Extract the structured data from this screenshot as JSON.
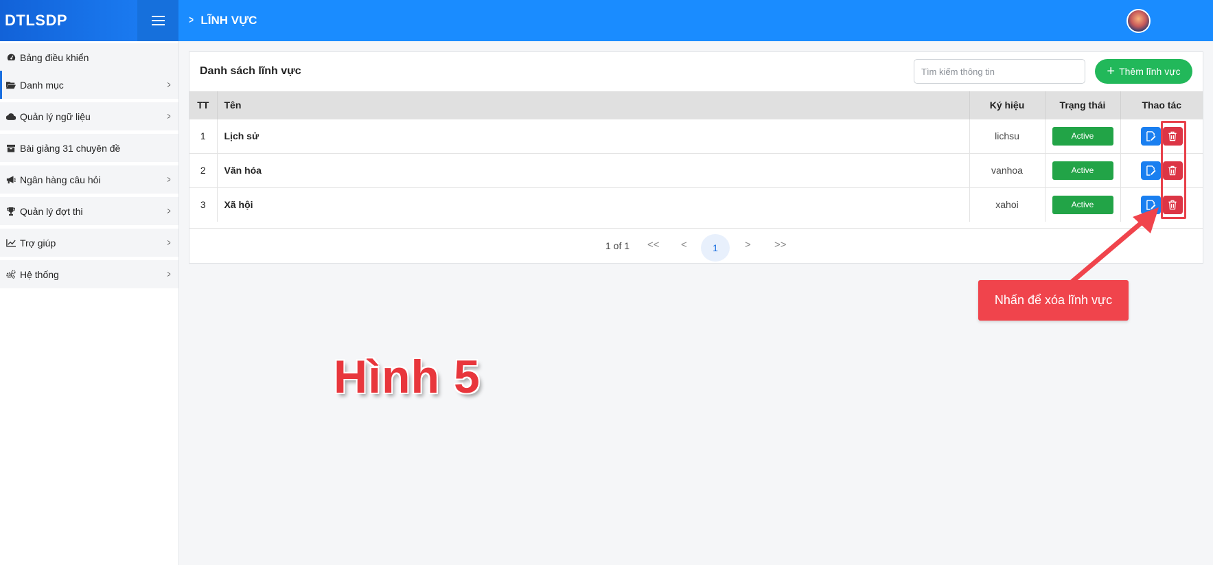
{
  "header": {
    "brand": "DTLSDP",
    "breadcrumb": "LĨNH VỰC"
  },
  "sidebar": {
    "items": [
      {
        "label": "Bảng điều khiển",
        "icon": "dashboard-icon",
        "has_arrow": false
      },
      {
        "label": "Danh mục",
        "icon": "folder-open-icon",
        "has_arrow": true,
        "active": true
      },
      {
        "label": "Quản lý ngữ liệu",
        "icon": "cloud-icon",
        "has_arrow": true
      },
      {
        "label": "Bài giảng 31 chuyên đề",
        "icon": "archive-icon",
        "has_arrow": false
      },
      {
        "label": "Ngân hàng câu hỏi",
        "icon": "megaphone-icon",
        "has_arrow": true
      },
      {
        "label": "Quản lý đợt thi",
        "icon": "trophy-icon",
        "has_arrow": true
      },
      {
        "label": "Trợ giúp",
        "icon": "chart-line-icon",
        "has_arrow": true
      },
      {
        "label": "Hệ thống",
        "icon": "cogs-icon",
        "has_arrow": true
      }
    ]
  },
  "card": {
    "title": "Danh sách lĩnh vực",
    "search_placeholder": "Tìm kiếm thông tin",
    "add_button": "Thêm lĩnh vực"
  },
  "table": {
    "headers": [
      "TT",
      "Tên",
      "Ký hiệu",
      "Trạng thái",
      "Thao tác"
    ],
    "rows": [
      {
        "tt": "1",
        "ten": "Lịch sử",
        "ky_hieu": "lichsu",
        "trang_thai": "Active"
      },
      {
        "tt": "2",
        "ten": "Văn hóa",
        "ky_hieu": "vanhoa",
        "trang_thai": "Active"
      },
      {
        "tt": "3",
        "ten": "Xã hội",
        "ky_hieu": "xahoi",
        "trang_thai": "Active"
      }
    ]
  },
  "pagination": {
    "info": "1 of 1",
    "first": "<<",
    "prev": "<",
    "current": "1",
    "next": ">",
    "last": ">>"
  },
  "annotations": {
    "callout": "Nhấn để xóa lĩnh vực",
    "figure_label": "Hình 5"
  },
  "colors": {
    "header": "#1a8cff",
    "add_button": "#22b85a",
    "badge": "#22a447",
    "edit_button": "#1a7ff0",
    "delete_button": "#dc3545",
    "callout": "#f0444c"
  }
}
